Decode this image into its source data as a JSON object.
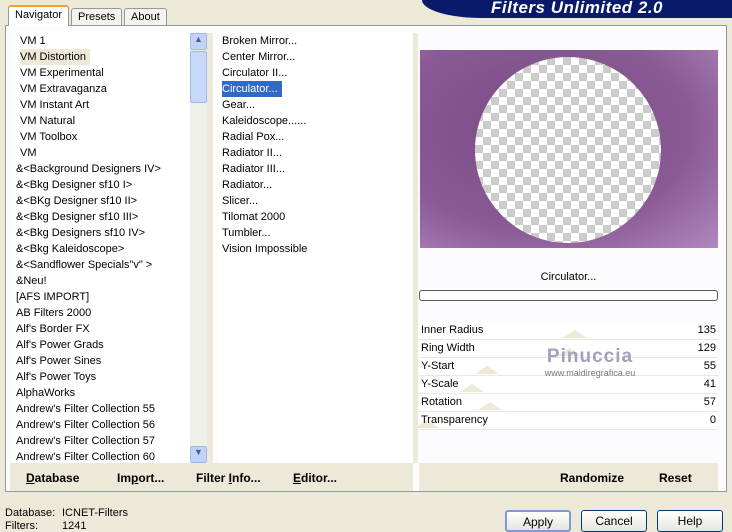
{
  "tabs": [
    "Navigator",
    "Presets",
    "About"
  ],
  "logo_text": "Filters Unlimited 2.0",
  "categories": [
    "VM 1",
    "VM Distortion",
    "VM Experimental",
    "VM Extravaganza",
    "VM Instant Art",
    "VM Natural",
    "VM Toolbox",
    "VM",
    "&<Background Designers IV>",
    "&<Bkg Designer sf10 I>",
    "&<BKg Designer sf10 II>",
    "&<Bkg Designer sf10 III>",
    "&<Bkg Designers sf10 IV>",
    "&<Bkg Kaleidoscope>",
    "&<Sandflower Specials\"v\" >",
    "&Neu!",
    "[AFS IMPORT]",
    "AB Filters 2000",
    "Alf's Border FX",
    "Alf's Power Grads",
    "Alf's Power Sines",
    "Alf's Power Toys",
    "AlphaWorks",
    "Andrew's Filter Collection 55",
    "Andrew's Filter Collection 56",
    "Andrew's Filter Collection 57",
    "Andrew's Filter Collection 60"
  ],
  "selected_category": 1,
  "filters": [
    "Broken Mirror...",
    "Center Mirror...",
    "Circulator II...",
    "Circulator...",
    "Gear...",
    "Kaleidoscope......",
    "Radial Pox...",
    "Radiator II...",
    "Radiator III...",
    "Radiator...",
    "Slicer...",
    "Tilomat 2000",
    "Tumbler...",
    "Vision Impossible"
  ],
  "selected_filter": 3,
  "filter_name": "Circulator...",
  "params": [
    {
      "label": "Inner Radius",
      "value": 135
    },
    {
      "label": "Ring Width",
      "value": 129
    },
    {
      "label": "Y-Start",
      "value": 55
    },
    {
      "label": "Y-Scale",
      "value": 41
    },
    {
      "label": "Rotation",
      "value": 57
    },
    {
      "label": "Transparency",
      "value": 0
    }
  ],
  "param_max": 255,
  "watermark": {
    "name": "Pinuccia",
    "url": "www.maidiregrafica.eu"
  },
  "left_buttons": [
    {
      "u": "D",
      "rest": "atabase"
    },
    {
      "pre": "Im",
      "u": "p",
      "rest": "ort..."
    },
    {
      "pre": "Filter ",
      "u": "I",
      "rest": "nfo..."
    },
    {
      "u": "E",
      "rest": "ditor..."
    }
  ],
  "right_buttons": [
    "Randomize",
    "Reset"
  ],
  "status": {
    "db_label": "Database:",
    "db_value": "ICNET-Filters",
    "filters_label": "Filters:",
    "filters_value": "1241"
  },
  "dialog_buttons": [
    "Apply",
    "Cancel",
    "Help"
  ],
  "colors": {
    "selection": "#316ac5",
    "preview": "#8a5a94"
  }
}
